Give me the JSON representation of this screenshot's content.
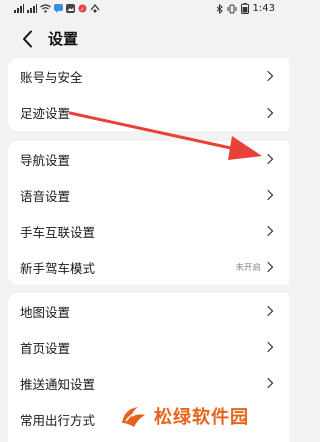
{
  "status_bar": {
    "time": "1:43",
    "icons": [
      "signal-icon",
      "signal-icon",
      "wifi-icon",
      "message-icon",
      "gallery-icon",
      "game-icon",
      "bluetooth-icon",
      "vibrate-icon",
      "battery-icon"
    ]
  },
  "header": {
    "title": "设置",
    "back_icon": "back-chevron-icon"
  },
  "groups": [
    {
      "items": [
        {
          "label": "账号与安全"
        },
        {
          "label": "足迹设置"
        }
      ]
    },
    {
      "items": [
        {
          "label": "导航设置"
        },
        {
          "label": "语音设置"
        },
        {
          "label": "手车互联设置"
        },
        {
          "label": "新手驾车模式",
          "value": "未开启"
        }
      ]
    },
    {
      "items": [
        {
          "label": "地图设置"
        },
        {
          "label": "首页设置"
        },
        {
          "label": "推送通知设置"
        },
        {
          "label": "常用出行方式"
        }
      ]
    }
  ],
  "annotation": {
    "color": "#e8413a"
  },
  "watermark": {
    "text": "松绿软件园",
    "color": "#e8641c"
  }
}
